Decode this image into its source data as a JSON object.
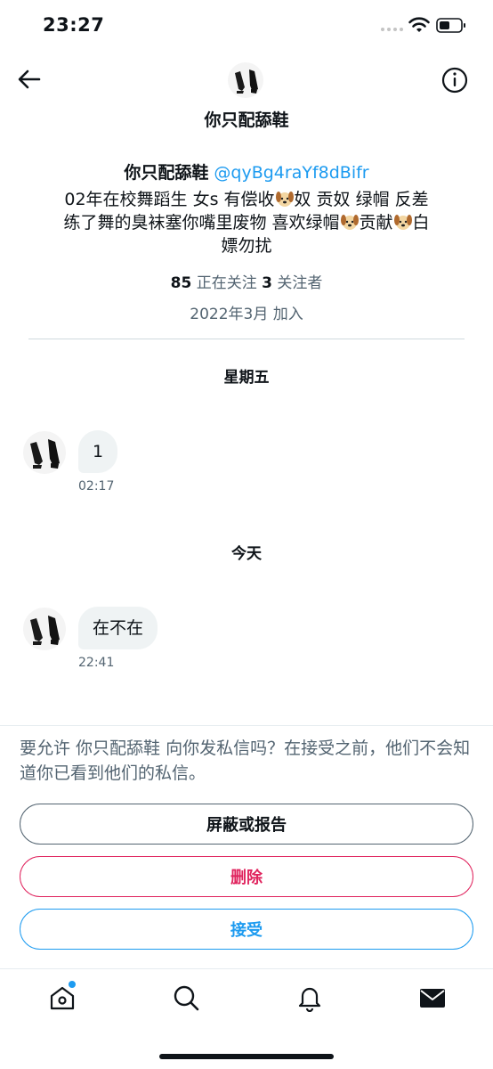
{
  "status_bar": {
    "time": "23:27"
  },
  "header": {
    "title": "你只配舔鞋"
  },
  "profile": {
    "name": "你只配舔鞋",
    "handle": "@qyBg4raYf8dBifr",
    "bio_parts": [
      "02年在校舞蹈生 女s 有偿收",
      "奴 贡奴 绿帽 反差",
      "练了舞的臭袜塞你嘴里废物 喜欢绿帽",
      "贡献",
      "白",
      "嫖勿扰"
    ],
    "following_count": "85",
    "following_label": "正在关注",
    "followers_count": "3",
    "followers_label": "关注者",
    "joined": "2022年3月 加入"
  },
  "conversation": [
    {
      "day": "星期五",
      "text": "1",
      "time": "02:17"
    },
    {
      "day": "今天",
      "text": "在不在",
      "time": "22:41"
    }
  ],
  "request": {
    "text": "要允许 你只配舔鞋 向你发私信吗？在接受之前，他们不会知道你已看到他们的私信。",
    "block_label": "屏蔽或报告",
    "delete_label": "删除",
    "accept_label": "接受"
  },
  "tabs": [
    "home-icon",
    "search-icon",
    "bell-icon",
    "mail-icon"
  ],
  "colors": {
    "accent": "#1d9bf0",
    "danger": "#e0245e",
    "muted": "#536471"
  }
}
